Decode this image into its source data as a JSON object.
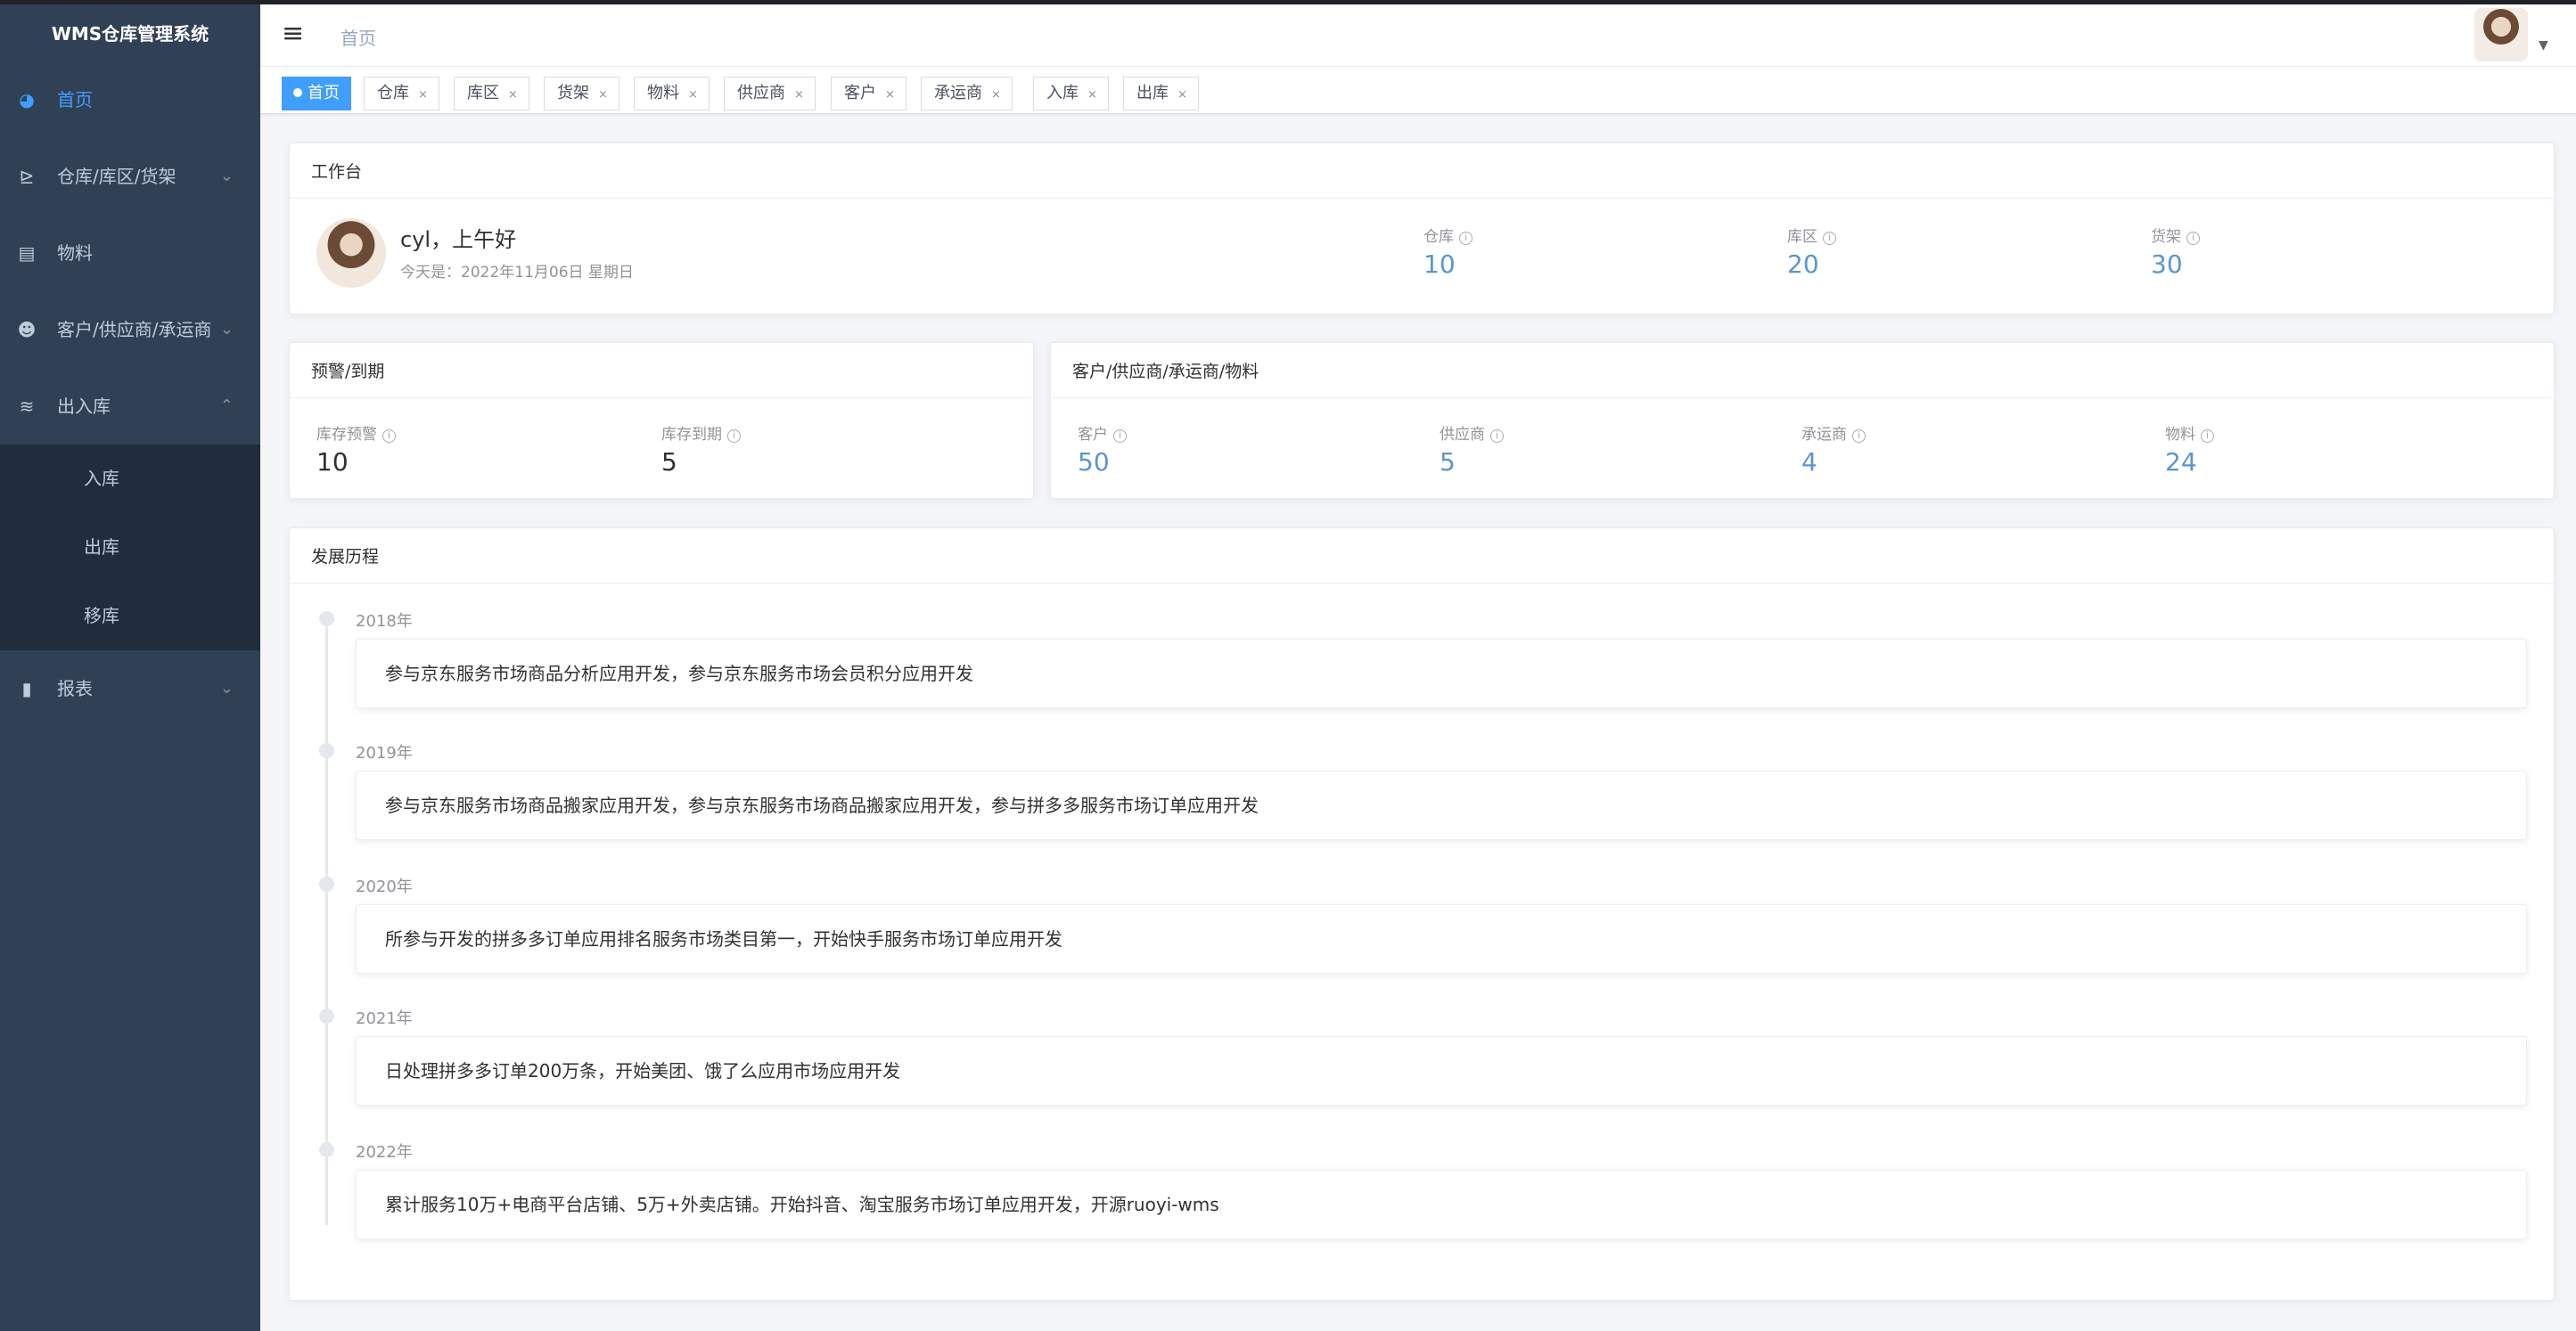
{
  "app": {
    "title": "WMS仓库管理系统"
  },
  "sidebar": {
    "items": [
      {
        "label": "首页",
        "icon": "dashboard-icon"
      },
      {
        "label": "仓库/库区/货架",
        "icon": "warehouse-icon"
      },
      {
        "label": "物料",
        "icon": "item-icon"
      },
      {
        "label": "客户/供应商/承运商",
        "icon": "people-icon"
      },
      {
        "label": "出入库",
        "icon": "layers-icon"
      },
      {
        "label": "报表",
        "icon": "chart-icon"
      }
    ],
    "submenu": [
      "入库",
      "出库",
      "移库"
    ]
  },
  "navbar": {
    "breadcrumb": "首页"
  },
  "tags": [
    {
      "label": "首页"
    },
    {
      "label": "仓库"
    },
    {
      "label": "库区"
    },
    {
      "label": "货架"
    },
    {
      "label": "物料"
    },
    {
      "label": "供应商"
    },
    {
      "label": "客户"
    },
    {
      "label": "承运商"
    },
    {
      "label": "入库"
    },
    {
      "label": "出库"
    }
  ],
  "workbench": {
    "title": "工作台",
    "greeting": "cyl，上午好",
    "today": "今天是：2022年11月06日 星期日",
    "stats": [
      {
        "label": "仓库",
        "value": "10"
      },
      {
        "label": "库区",
        "value": "20"
      },
      {
        "label": "货架",
        "value": "30"
      }
    ]
  },
  "warning": {
    "title": "预警/到期",
    "stats": [
      {
        "label": "库存预警",
        "value": "10"
      },
      {
        "label": "库存到期",
        "value": "5"
      }
    ]
  },
  "partners": {
    "title": "客户/供应商/承运商/物料",
    "stats": [
      {
        "label": "客户",
        "value": "50"
      },
      {
        "label": "供应商",
        "value": "5"
      },
      {
        "label": "承运商",
        "value": "4"
      },
      {
        "label": "物料",
        "value": "24"
      }
    ]
  },
  "history": {
    "title": "发展历程",
    "events": [
      {
        "year": "2018年",
        "text": "参与京东服务市场商品分析应用开发，参与京东服务市场会员积分应用开发"
      },
      {
        "year": "2019年",
        "text": "参与京东服务市场商品搬家应用开发，参与京东服务市场商品搬家应用开发，参与拼多多服务市场订单应用开发"
      },
      {
        "year": "2020年",
        "text": "所参与开发的拼多多订单应用排名服务市场类目第一，开始快手服务市场订单应用开发"
      },
      {
        "year": "2021年",
        "text": "日处理拼多多订单200万条，开始美团、饿了么应用市场应用开发"
      },
      {
        "year": "2022年",
        "text": "累计服务10万+电商平台店铺、5万+外卖店铺。开始抖音、淘宝服务市场订单应用开发，开源ruoyi-wms"
      }
    ]
  },
  "colors": {
    "sidebar_bg": "#304156",
    "accent": "#409eff",
    "stat_value": "#5b95d0"
  }
}
